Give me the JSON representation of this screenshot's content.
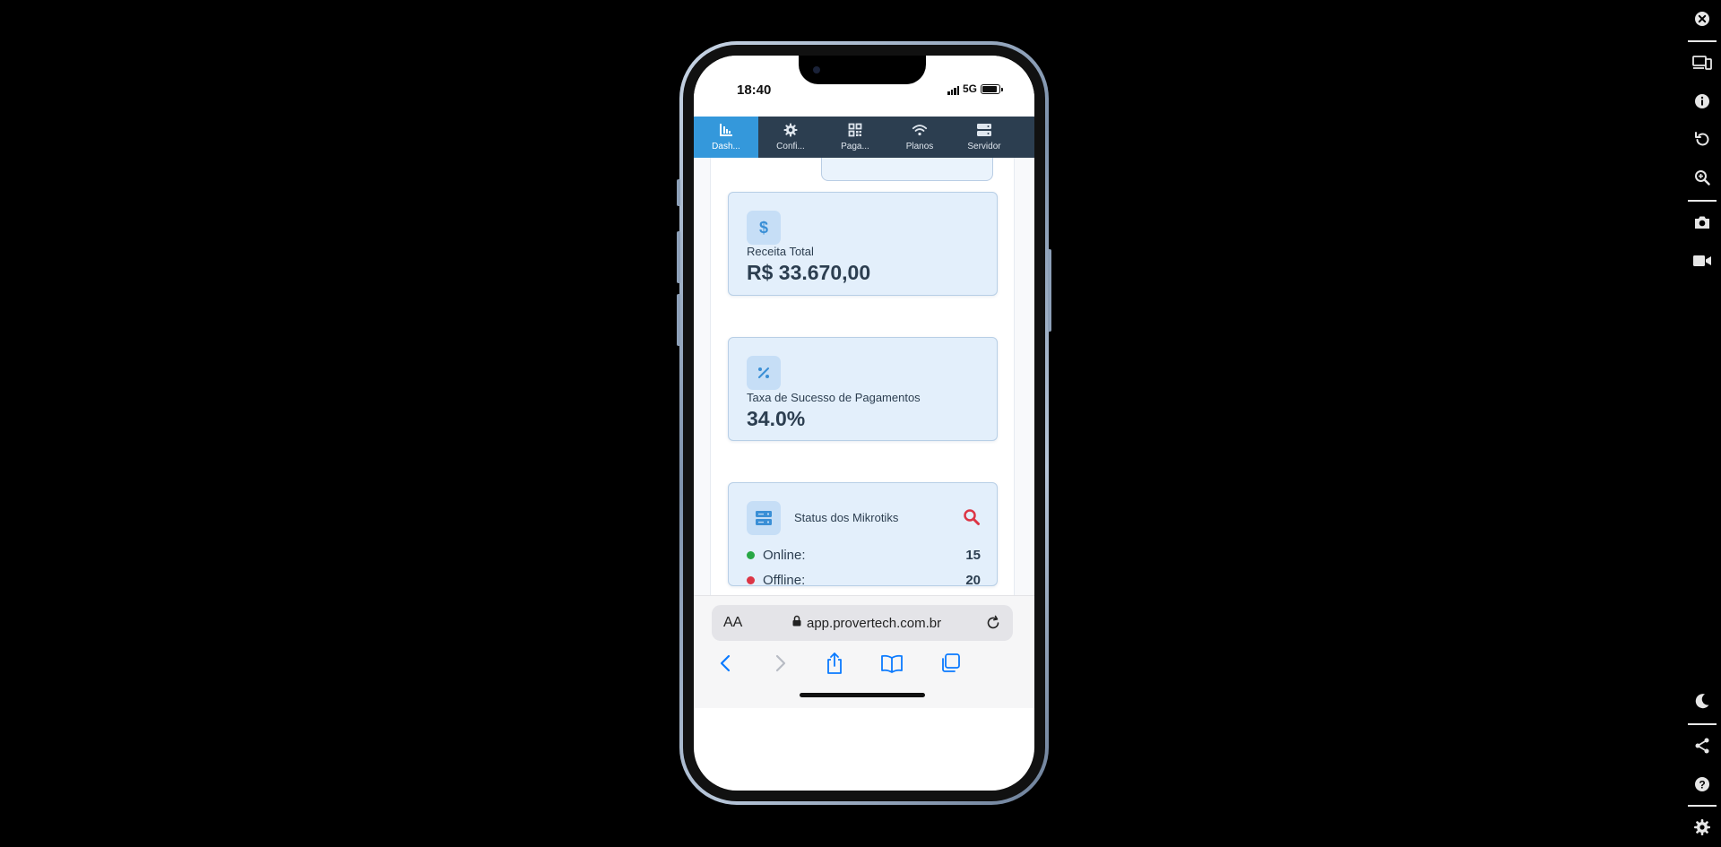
{
  "status_bar": {
    "time": "18:40",
    "network": "5G"
  },
  "app_nav": {
    "items": [
      {
        "label": "Dash...",
        "icon": "chart-bar-icon",
        "active": true
      },
      {
        "label": "Confi...",
        "icon": "gear-icon",
        "active": false
      },
      {
        "label": "Paga...",
        "icon": "qrcode-icon",
        "active": false
      },
      {
        "label": "Planos",
        "icon": "wifi-icon",
        "active": false
      },
      {
        "label": "Servidor",
        "icon": "server-icon",
        "active": false
      }
    ]
  },
  "cards": {
    "revenue": {
      "icon": "dollar-icon",
      "label": "Receita Total",
      "value": "R$ 33.670,00"
    },
    "success_rate": {
      "icon": "percent-icon",
      "label": "Taxa de Sucesso de Pagamentos",
      "value": "34.0%"
    },
    "mikrotik": {
      "icon": "server-icon",
      "title": "Status dos Mikrotiks",
      "search_icon": "search-icon",
      "online_label": "Online:",
      "online_value": "15",
      "offline_label": "Offline:",
      "offline_value": "20"
    },
    "next": {
      "icon": "check-circle-icon"
    }
  },
  "safari": {
    "aa_label": "AA",
    "url": "app.provertech.com.br"
  },
  "colors": {
    "nav_bg": "#2c3e50",
    "nav_active": "#3498db",
    "card_bg": "#e3effb",
    "icon_box": "#c6def6",
    "icon_blue": "#3a8fd6",
    "online": "#28a745",
    "offline": "#dc3545",
    "ios_blue": "#0a7aff"
  }
}
